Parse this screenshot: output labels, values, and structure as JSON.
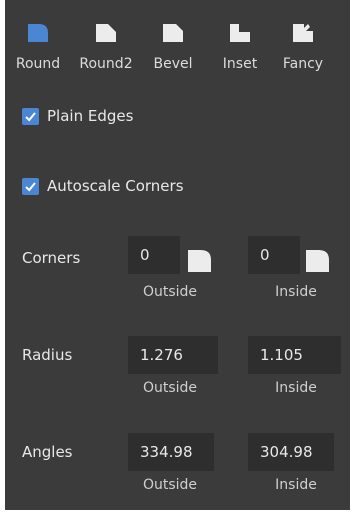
{
  "styles": [
    {
      "label": "Round",
      "icon": "round-corner-icon",
      "active": true
    },
    {
      "label": "Round2",
      "icon": "round2-corner-icon",
      "active": false
    },
    {
      "label": "Bevel",
      "icon": "bevel-corner-icon",
      "active": false
    },
    {
      "label": "Inset",
      "icon": "inset-corner-icon",
      "active": false
    },
    {
      "label": "Fancy",
      "icon": "fancy-corner-icon",
      "active": false
    }
  ],
  "options": {
    "plain_edges": {
      "label": "Plain Edges",
      "checked": true
    },
    "autoscale_corners": {
      "label": "Autoscale Corners",
      "checked": true
    }
  },
  "corners": {
    "label": "Corners",
    "outside": {
      "value": "0",
      "sub": "Outside",
      "icon": "round-corner-icon"
    },
    "inside": {
      "value": "0",
      "sub": "Inside",
      "icon": "round-corner-icon"
    }
  },
  "radius": {
    "label": "Radius",
    "outside": {
      "value": "1.276",
      "sub": "Outside"
    },
    "inside": {
      "value": "1.105",
      "sub": "Inside"
    }
  },
  "angles": {
    "label": "Angles",
    "outside": {
      "value": "334.98",
      "sub": "Outside"
    },
    "inside": {
      "value": "304.98",
      "sub": "Inside"
    }
  },
  "colors": {
    "panel": "#3b3b3b",
    "field": "#2e2e2e",
    "accent": "#4b86d2",
    "icon_inactive": "#ececec"
  }
}
